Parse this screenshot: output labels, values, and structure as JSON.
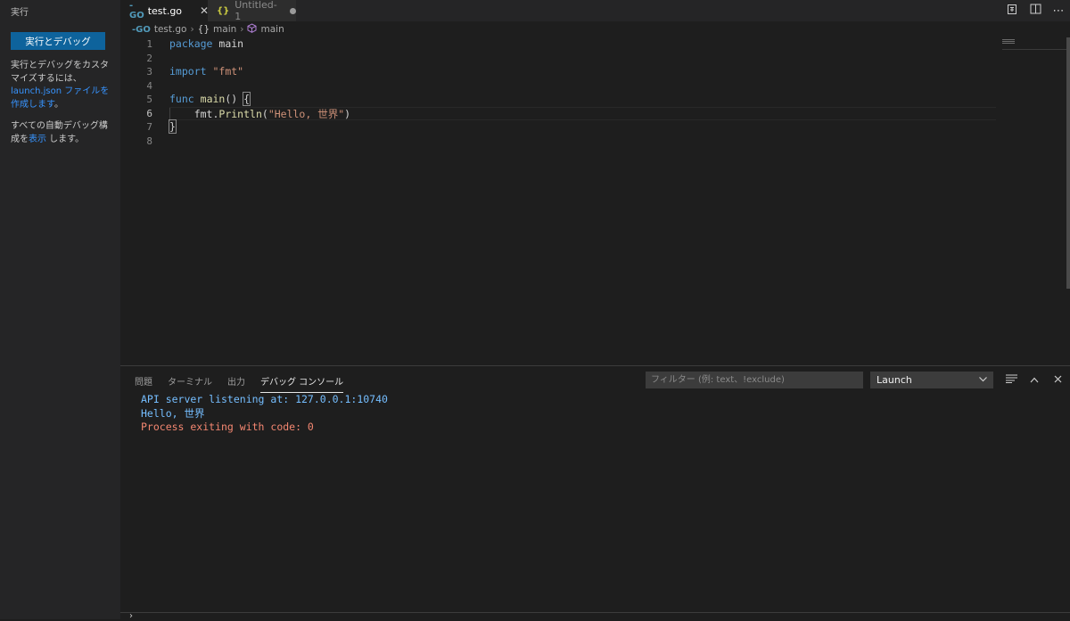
{
  "sidebar": {
    "title": "実行",
    "run_button": "実行とデバッグ",
    "help_prefix": "実行とデバッグをカスタマイズするには、",
    "help_link": "launch.json ファイルを作成します",
    "help_suffix": "。",
    "auto_prefix": "すべての自動デバッグ構成を",
    "auto_link": "表示",
    "auto_suffix": " します。"
  },
  "tabs": [
    {
      "label": "test.go",
      "icon": "go-file-icon",
      "close": "✕"
    },
    {
      "label": "Untitled-1",
      "icon": "json-file-icon"
    }
  ],
  "breadcrumb": {
    "file": "test.go",
    "scope": "main",
    "symbol": "main"
  },
  "editor": {
    "line_numbers": [
      "1",
      "2",
      "3",
      "4",
      "5",
      "6",
      "7",
      "8"
    ],
    "current_line": 6,
    "lines": [
      {
        "kw": "package",
        "rest": " main"
      },
      {},
      {
        "kw": "import",
        "str": "\"fmt\""
      },
      {},
      {
        "kw": "func",
        "fn": "main",
        "rest": "() "
      },
      {
        "pre": "fmt.",
        "fn": "Println",
        "open": "(",
        "str": "\"Hello, 世界\"",
        "close": ")"
      },
      {
        "close": "}"
      },
      {}
    ],
    "open_brace": "{"
  },
  "panel": {
    "tabs": [
      "問題",
      "ターミナル",
      "出力",
      "デバッグ コンソール"
    ],
    "active_tab": 3,
    "filter_placeholder": "フィルター (例: text、!exclude)",
    "config_select": "Launch",
    "console_lines": [
      {
        "text": "API server listening at: 127.0.0.1:10740",
        "color": "#75beff"
      },
      {
        "text": "Hello, 世界",
        "color": "#75beff"
      },
      {
        "text": "Process exiting with code: 0",
        "color": "#f48771"
      }
    ]
  },
  "colors": {
    "accent": "#0e639c",
    "link": "#3794ff",
    "keyword": "#569cd6",
    "function": "#dcdcaa",
    "string": "#ce9178"
  }
}
